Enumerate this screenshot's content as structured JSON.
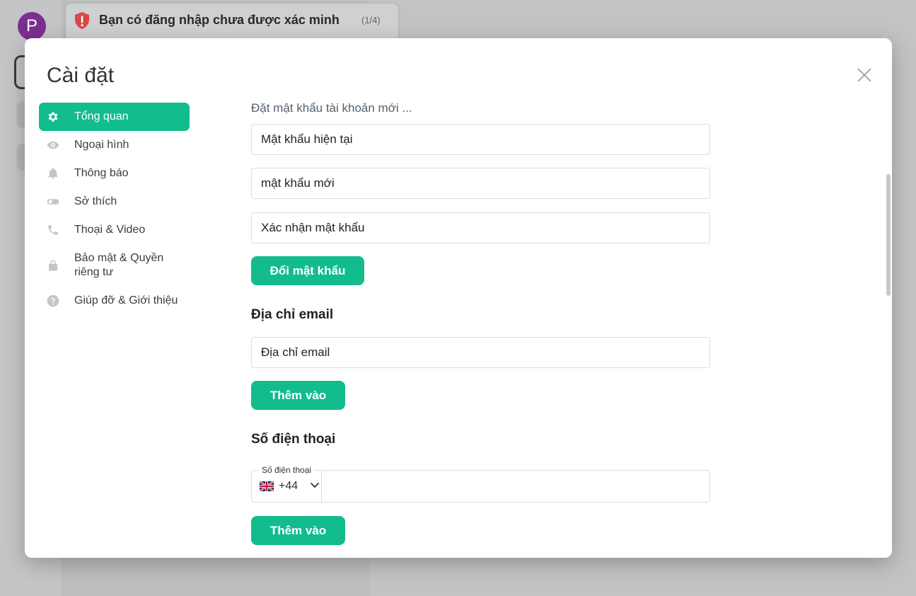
{
  "app": {
    "avatar_letter": "P",
    "banner": {
      "text": "Bạn có đăng nhập chưa được xác minh",
      "count": "(1/4)",
      "icon": "shield-alert-icon"
    }
  },
  "modal": {
    "title": "Cài đặt",
    "close_icon": "close-icon",
    "sidebar": {
      "items": [
        {
          "label": "Tổng quan",
          "icon": "gear-icon",
          "active": true
        },
        {
          "label": "Ngoại hình",
          "icon": "eye-icon",
          "active": false
        },
        {
          "label": "Thông báo",
          "icon": "bell-icon",
          "active": false
        },
        {
          "label": "Sở thích",
          "icon": "toggle-icon",
          "active": false
        },
        {
          "label": "Thoại & Video",
          "icon": "phone-icon",
          "active": false
        },
        {
          "label": "Bảo mật & Quyền riêng tư",
          "icon": "lock-icon",
          "active": false
        },
        {
          "label": "Giúp đỡ & Giới thiệu",
          "icon": "help-icon",
          "active": false
        }
      ]
    },
    "password": {
      "label": "Đặt mật khẩu tài khoản mới ...",
      "current_placeholder": "Mật khẩu hiện tại",
      "new_placeholder": "mật khẩu mới",
      "confirm_placeholder": "Xác nhận mật khẩu",
      "button": "Đổi mật khẩu"
    },
    "email": {
      "heading": "Địa chỉ email",
      "placeholder": "Địa chỉ email",
      "button": "Thêm vào"
    },
    "phone": {
      "heading": "Số điện thoại",
      "field_label": "Số điện thoại",
      "country_code": "+44",
      "value": "",
      "button": "Thêm vào"
    }
  },
  "colors": {
    "accent": "#12bc8c",
    "banner_alert": "#d94848",
    "avatar": "#7b2f91"
  }
}
